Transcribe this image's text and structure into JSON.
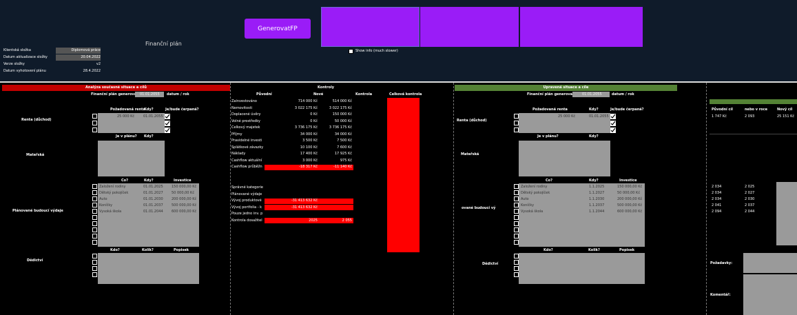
{
  "header": {
    "title": "Finanční plán",
    "generate_button": "GenerovatFP",
    "show_info": "Show info (much slower)"
  },
  "info": [
    {
      "label": "Klientská složka",
      "value": "Diplomová práce"
    },
    {
      "label": "Datum aktualizace složky",
      "value": "20.04.2022"
    },
    {
      "label": "Verze složky",
      "value": "v2"
    },
    {
      "label": "Datum vyhotovení plánu",
      "value": "28.4.2022"
    }
  ],
  "left": {
    "title": "Analýza současné situace a cílů",
    "plan_label": "Finanční plán generovat do",
    "plan_value": "01.01.2055",
    "plan_unit": "datum / rok",
    "renta": {
      "section": "Renta (důchod)",
      "h1": "Požadovaná renta",
      "h2": "Kdy?",
      "h3": "Je/bude čerpaná?",
      "amount": "25 000 Kč",
      "date": "01.01.2055"
    },
    "materska": {
      "section": "Mateřská",
      "h1": "Je v plánu?",
      "h2": "Kdy?"
    },
    "vydaje": {
      "section": "Plánované budoucí výdaje",
      "h1": "Co?",
      "h2": "Kdy?",
      "h3": "Investice",
      "rows": [
        {
          "co": "Založení rodiny",
          "kdy": "01.01.2025",
          "inv": "150 000,00 Kč"
        },
        {
          "co": "Dětský pokojíček",
          "kdy": "01.01.2027",
          "inv": "50 000,00 Kč"
        },
        {
          "co": "Auto",
          "kdy": "01.01.2030",
          "inv": "200 000,00 Kč"
        },
        {
          "co": "Koníčky",
          "kdy": "01.01.2037",
          "inv": "500 000,00 Kč"
        },
        {
          "co": "Vysoká škola",
          "kdy": "01.01.2044",
          "inv": "600 000,00 Kč"
        }
      ]
    },
    "dedictvi": {
      "section": "Dědictví",
      "h1": "Kdo?",
      "h2": "Kolik?",
      "h3": "Popisek"
    }
  },
  "kontroly": {
    "title": "Kontroly",
    "h_puvodni": "Původní",
    "h_nove": "Nové",
    "h_kontrola": "Kontrola",
    "h_celkova": "Celková kontrola",
    "rows": [
      {
        "label": "Zainvestováno",
        "puv": "714 000 Kč",
        "nove": "514 000 Kč",
        "red": false
      },
      {
        "label": "Nemovitosti",
        "puv": "3 022 175 Kč",
        "nove": "3 022 175 Kč",
        "red": false
      },
      {
        "label": "Doplacené úvěry",
        "puv": "0 Kč",
        "nove": "150 000 Kč",
        "red": false
      },
      {
        "label": "Volné prostředky",
        "puv": "0 Kč",
        "nove": "50 000 Kč",
        "red": false
      },
      {
        "label": "Celkový majetek",
        "puv": "3 736 175 Kč",
        "nove": "3 736 175 Kč",
        "red": false
      },
      {
        "label": "Příjmy",
        "puv": "34 000 Kč",
        "nove": "34 000 Kč",
        "red": false
      },
      {
        "label": "Pravidelné investi",
        "puv": "3 500 Kč",
        "nove": "7 500 Kč",
        "red": false
      },
      {
        "label": "Splátkové závazky",
        "puv": "10 100 Kč",
        "nove": "7 600 Kč",
        "red": false
      },
      {
        "label": "Náklady",
        "puv": "17 400 Kč",
        "nove": "17 925 Kč",
        "red": false
      },
      {
        "label": "Cashflow aktuální",
        "puv": "3 000 Kč",
        "nove": "975 Kč",
        "red": false
      },
      {
        "label": "Cashflow průběžn",
        "puv": "-18 317 Kč",
        "nove": "-11 140 Kč",
        "red": true
      }
    ],
    "rows2": [
      {
        "label": "Správné kategorie",
        "puv": "",
        "nove": "",
        "red": false
      },
      {
        "label": "Plánované výdaje",
        "puv": "",
        "nove": "",
        "red": false
      },
      {
        "label": "Vývoj produktové",
        "puv": "-31 413 632 Kč",
        "nove": "",
        "red": true
      },
      {
        "label": "Vývoj portfolia - k",
        "puv": "-31 413 632 Kč",
        "nove": "",
        "red": true
      },
      {
        "label": "Pouze jedno inv. p",
        "puv": "",
        "nove": "",
        "red": false
      },
      {
        "label": "Kontrola dosažitel",
        "puv": "2025",
        "nove": "2 055",
        "red": true
      }
    ]
  },
  "right": {
    "title": "Upravená situace a cíle",
    "plan_label": "Finanční plán generovat do",
    "plan_value": "01.01.2055",
    "plan_unit": "datum / rok",
    "renta": {
      "section": "Renta (důchod)",
      "h1": "Požadovaná renta",
      "h2": "Kdy?",
      "h3": "Je/bude čerpaná?",
      "amount": "25 000 Kč",
      "date": "01.01.2055"
    },
    "materska": {
      "section": "Mateřská",
      "h1": "Je v plánu?",
      "h2": "Kdy?"
    },
    "vydaje": {
      "section": "ované budoucí vý",
      "h1": "Co?",
      "h2": "Kdy?",
      "h3": "Investice",
      "rows": [
        {
          "co": "Založení rodiny",
          "kdy": "1.1.2025",
          "inv": "150 000,00 Kč"
        },
        {
          "co": "Dětský pokojíček",
          "kdy": "1.1.2027",
          "inv": "50 000,00 Kč"
        },
        {
          "co": "Auto",
          "kdy": "1.1.2030",
          "inv": "200 000,00 Kč"
        },
        {
          "co": "Koníčky",
          "kdy": "1.1.2037",
          "inv": "500 000,00 Kč"
        },
        {
          "co": "Vysoká škola",
          "kdy": "1.1.2044",
          "inv": "600 000,00 Kč"
        }
      ]
    },
    "dedictvi": {
      "section": "Dědictví",
      "h1": "Kdo?",
      "h2": "Kolik?",
      "h3": "Popisek"
    }
  },
  "far": {
    "h1": "Původní cíl",
    "h2": "nebo v roce",
    "h3": "Nový cíl",
    "renta": {
      "a": "1 747 Kč",
      "b": "2 093",
      "c": "25 151 Kč"
    },
    "rows": [
      {
        "a": "2 034",
        "b": "2 025"
      },
      {
        "a": "2 034",
        "b": "2 027"
      },
      {
        "a": "2 034",
        "b": "2 030"
      },
      {
        "a": "2 041",
        "b": "2 037"
      },
      {
        "a": "2 094",
        "b": "2 044"
      }
    ],
    "pozadavky": "Požadavky:",
    "komentar": "Komentář:"
  },
  "colors": {
    "purple": "#9a1cf7",
    "red_header": "#c00000",
    "green_header": "#548235",
    "red": "#ff0000",
    "grey": "#9a9a9a"
  }
}
